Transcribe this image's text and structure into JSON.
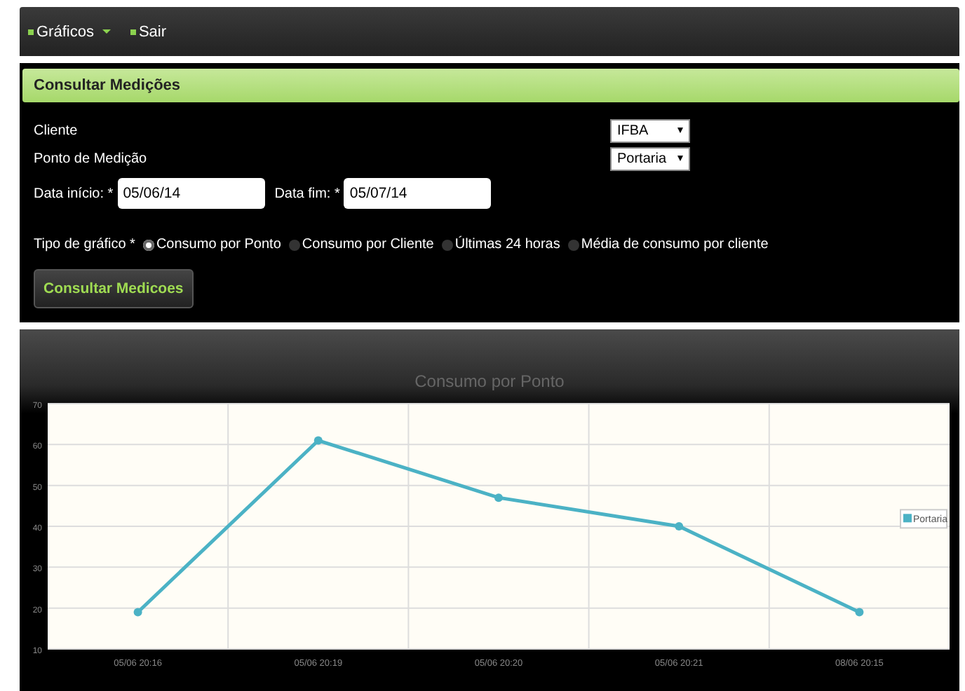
{
  "nav": [
    {
      "label": "Gráficos",
      "has_caret": true
    },
    {
      "label": "Sair",
      "has_caret": false
    }
  ],
  "panel": {
    "title": "Consultar Medições",
    "selects": [
      {
        "label": "Cliente",
        "value": "IFBA"
      },
      {
        "label": "Ponto de Medição",
        "value": "Portaria"
      }
    ],
    "dates": [
      {
        "label": "Data início: *",
        "value": "05/06/14"
      },
      {
        "label": "Data fim: *",
        "value": "05/07/14"
      }
    ],
    "chart_type": {
      "label": "Tipo de gráfico *",
      "options": [
        {
          "label": "Consumo por Ponto",
          "selected": true
        },
        {
          "label": "Consumo por Cliente",
          "selected": false
        },
        {
          "label": "Últimas 24 horas",
          "selected": false
        },
        {
          "label": "Média de consumo por cliente",
          "selected": false
        }
      ]
    },
    "submit": "Consultar Medicoes"
  },
  "chart": {
    "chart_data": {
      "type": "line",
      "title": "Consumo por Ponto",
      "categories": [
        "05/06 20:16",
        "05/06 20:19",
        "05/06 20:20",
        "05/06 20:21",
        "08/06 20:15"
      ],
      "series": [
        {
          "name": "Portaria",
          "color": "#4bb2c5",
          "marker": "circle",
          "values": [
            19,
            61,
            47,
            40,
            19
          ]
        }
      ],
      "grid": true,
      "ylim": [
        10,
        70
      ],
      "yticks": [
        10,
        20,
        30,
        40,
        50,
        60,
        70
      ]
    }
  }
}
